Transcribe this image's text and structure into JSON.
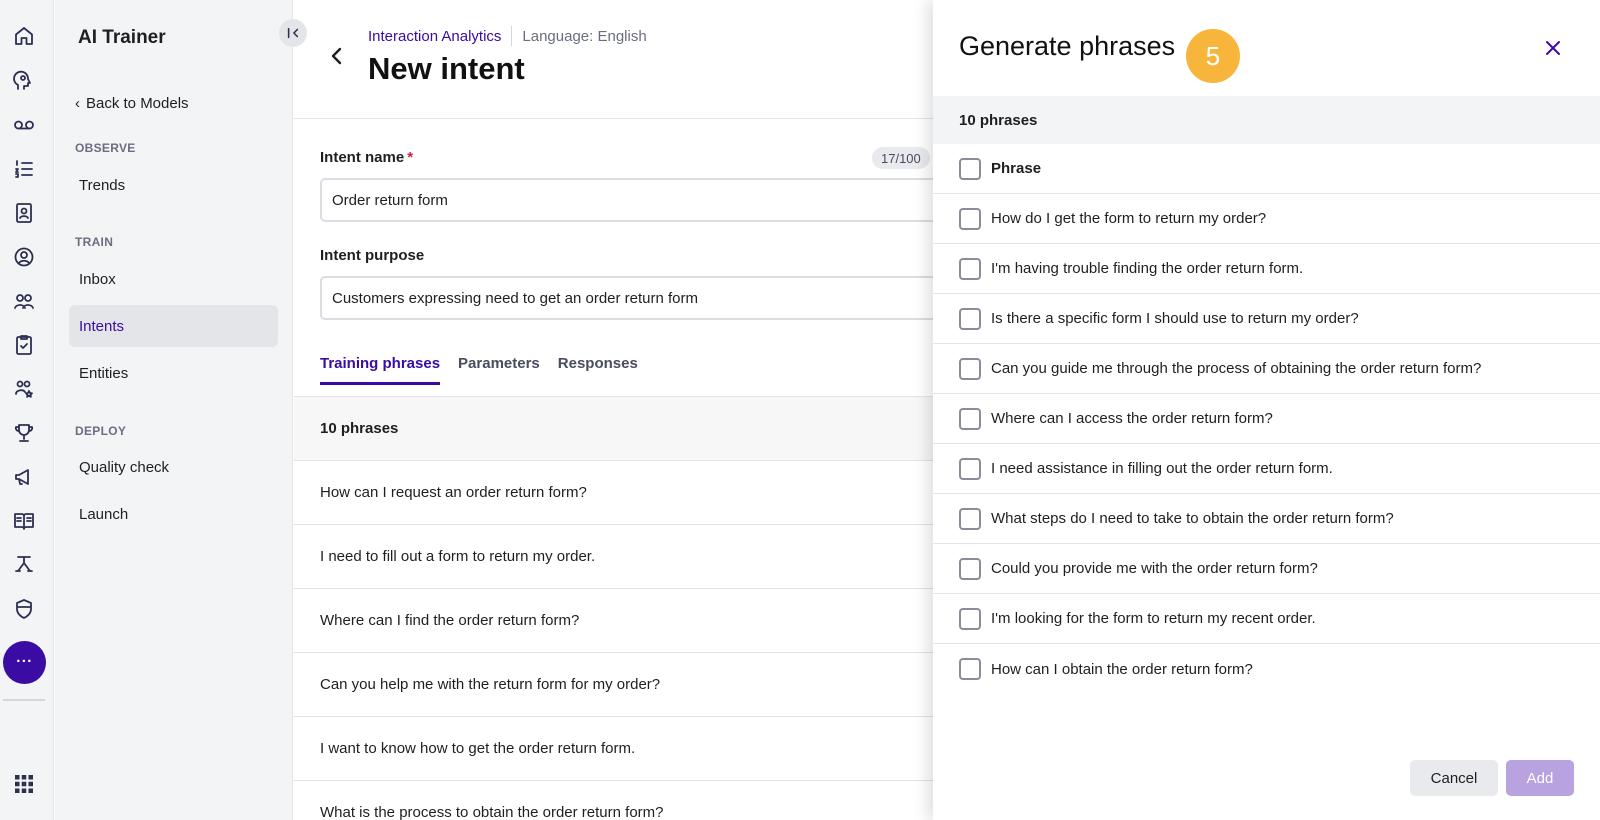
{
  "nav": {
    "title": "AI Trainer",
    "back": "Back to Models",
    "sections": [
      {
        "label": "OBSERVE",
        "items": [
          "Trends"
        ]
      },
      {
        "label": "TRAIN",
        "items": [
          "Inbox",
          "Intents",
          "Entities"
        ]
      },
      {
        "label": "DEPLOY",
        "items": [
          "Quality check",
          "Launch"
        ]
      }
    ],
    "active_item": "Intents"
  },
  "rail": {
    "icons": [
      "home-icon",
      "brain-icon",
      "voicemail-icon",
      "list-numbered-icon",
      "contact-book-icon",
      "user-circle-icon",
      "users-icon",
      "clipboard-check-icon",
      "users-star-icon",
      "trophy-icon",
      "megaphone-icon",
      "book-icon",
      "flow-icon",
      "shield-icon"
    ],
    "more_label": "···",
    "apps_icon": "grid-icon"
  },
  "header": {
    "breadcrumb": "Interaction Analytics",
    "language": "Language: English",
    "title": "New intent"
  },
  "form": {
    "intent_name_label": "Intent name",
    "required_mark": "*",
    "counter": "17/100",
    "intent_name_value": "Order return form",
    "intent_purpose_label": "Intent purpose",
    "intent_purpose_value": "Customers expressing need to get an order return form"
  },
  "tabs": [
    "Training phrases",
    "Parameters",
    "Responses"
  ],
  "active_tab": "Training phrases",
  "phrases": {
    "count_label": "10 phrases",
    "items": [
      "How can I request an order return form?",
      "I need to fill out a form to return my order.",
      "Where can I find the order return form?",
      "Can you help me with the return form for my order?",
      "I want to know how to get the order return form.",
      "What is the process to obtain the order return form?"
    ]
  },
  "drawer": {
    "title": "Generate phrases",
    "step": "5",
    "count_label": "10 phrases",
    "column_header": "Phrase",
    "items": [
      "How do I get the form to return my order?",
      "I'm having trouble finding the order return form.",
      "Is there a specific form I should use to return my order?",
      "Can you guide me through the process of obtaining the order return form?",
      "Where can I access the order return form?",
      "I need assistance in filling out the order return form.",
      "What steps do I need to take to obtain the order return form?",
      "Could you provide me with the order return form?",
      "I'm looking for the form to return my recent order.",
      "How can I obtain the order return form?"
    ],
    "cancel_label": "Cancel",
    "add_label": "Add"
  },
  "colors": {
    "accent": "#3a0ca3",
    "badge": "#f7b63b",
    "add_disabled": "#b8a3e0",
    "required": "#c6262e"
  }
}
